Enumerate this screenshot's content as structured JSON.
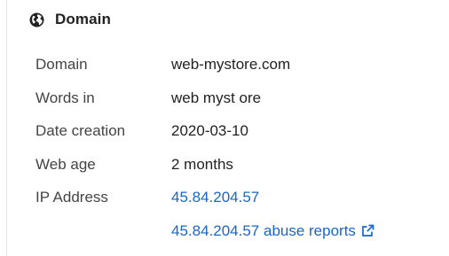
{
  "header": {
    "icon": "globe-icon",
    "title": "Domain"
  },
  "rows": [
    {
      "label": "Domain",
      "value": "web-mystore.com"
    },
    {
      "label": "Words in",
      "value": "web myst ore"
    },
    {
      "label": "Date creation",
      "value": "2020-03-10"
    },
    {
      "label": "Web age",
      "value": "2 months"
    },
    {
      "label": "IP Address",
      "value": "45.84.204.57"
    }
  ],
  "abuse_link": {
    "text": "45.84.204.57 abuse reports",
    "icon": "external-link-icon"
  },
  "colors": {
    "link": "#1a66c6",
    "label": "#444444",
    "text": "#222222"
  }
}
